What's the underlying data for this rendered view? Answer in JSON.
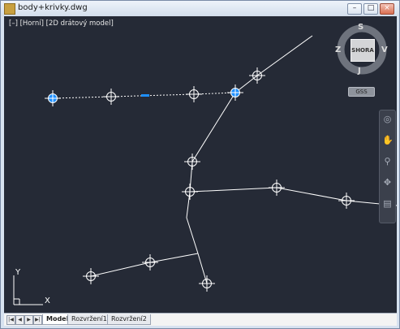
{
  "window": {
    "title": "body+krivky.dwg",
    "minimize_glyph": "–",
    "maximize_glyph": "□",
    "close_glyph": "×"
  },
  "viewport_label": {
    "control": "[–]",
    "view": "[Horní]",
    "style": "[2D drátový model]"
  },
  "viewcube": {
    "face": "SHORA",
    "north": "S",
    "south": "J",
    "east": "V",
    "west": "Z",
    "wcs_menu": "GSS"
  },
  "ucs": {
    "x_label": "X",
    "y_label": "Y"
  },
  "layout_tabs": [
    {
      "label": "Model",
      "active": true
    },
    {
      "label": "Rozvržení1",
      "active": false
    },
    {
      "label": "Rozvržení2",
      "active": false
    }
  ],
  "colors": {
    "viewport_bg": "#252a36",
    "geometry": "#ffffff",
    "selection": "#1e8fff"
  },
  "navbar_icons": [
    "steering-wheel-icon",
    "pan-icon",
    "zoom-icon",
    "orbit-icon",
    "showmotion-icon"
  ],
  "tab_nav_icons": [
    "first-tab-icon",
    "prev-tab-icon",
    "next-tab-icon",
    "last-tab-icon"
  ]
}
